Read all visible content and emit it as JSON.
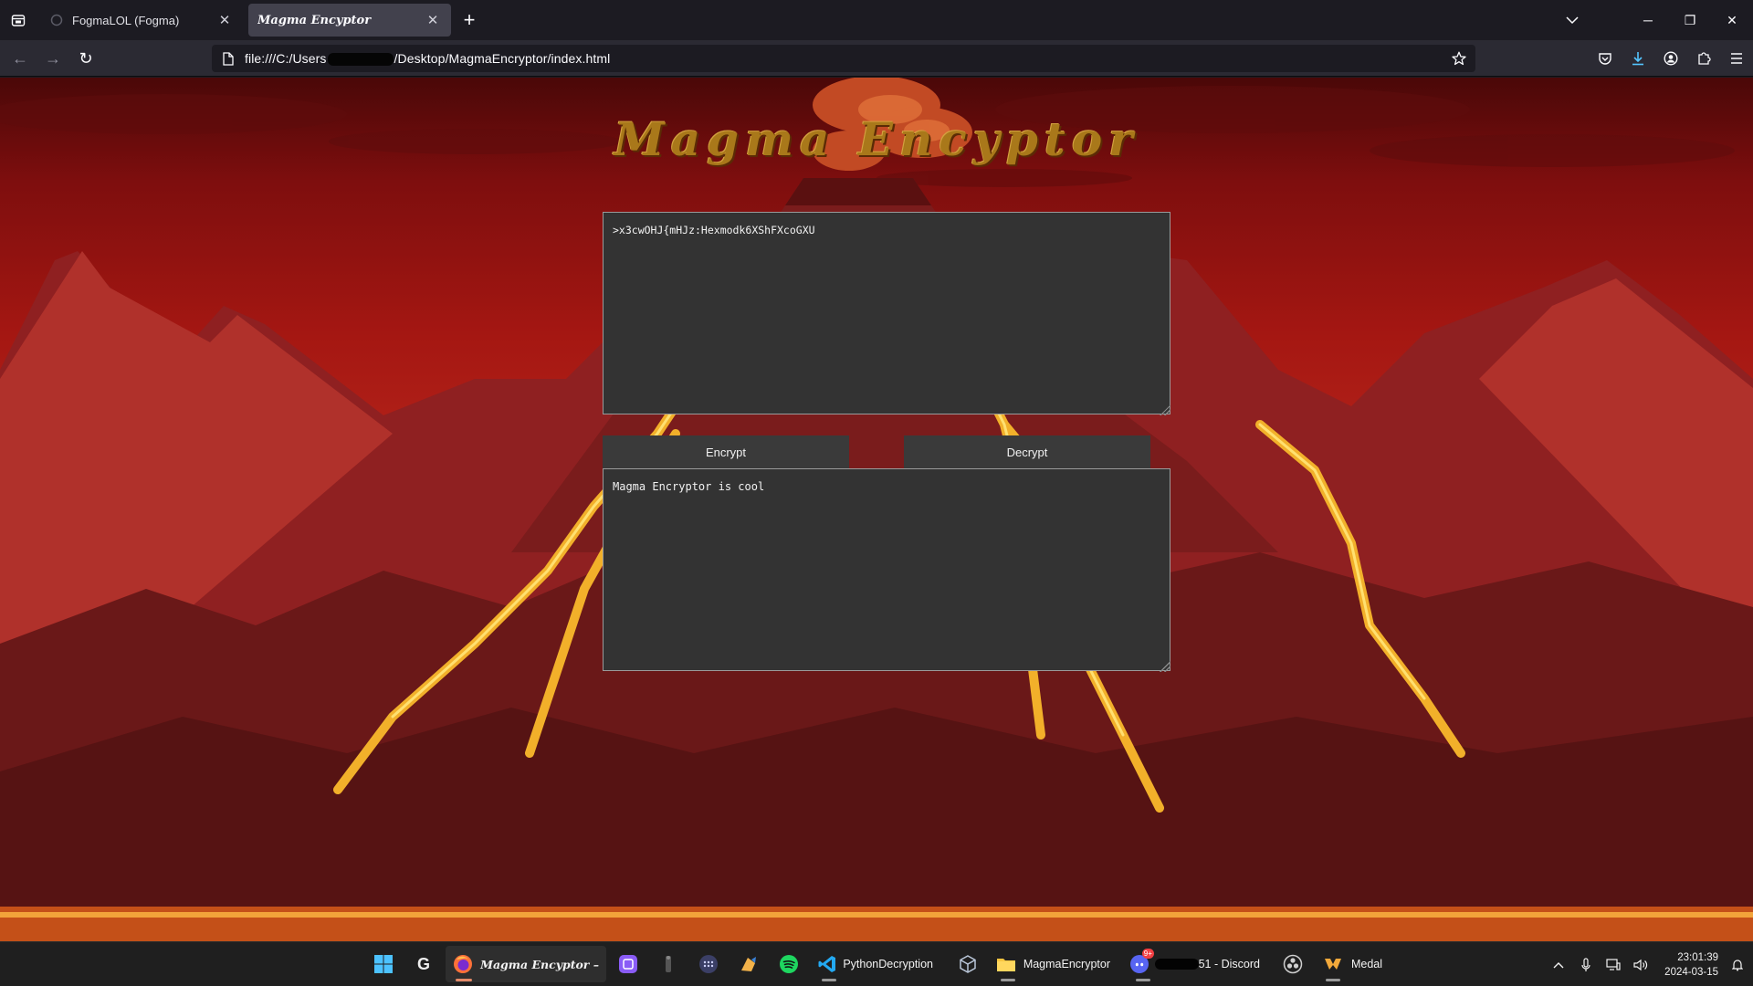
{
  "browser": {
    "tabs": [
      {
        "title": "FogmaLOL (Fogma)",
        "active": false
      },
      {
        "title": "Magma Encyptor",
        "active": true
      }
    ],
    "url": {
      "prefix": "file:///C:/Users",
      "suffix": "/Desktop/MagmaEncryptor/index.html"
    }
  },
  "page": {
    "title": "Magma Encyptor",
    "input_text": ">x3cwOHJ{mHJz:Hexmodk6XShFXcoGXU",
    "output_text": "Magma Encryptor is cool",
    "encrypt_label": "Encrypt",
    "decrypt_label": "Decrypt"
  },
  "taskbar": {
    "items": [
      {
        "label": "Magma Encyptor –",
        "icon": "firefox-icon"
      },
      {
        "label": "PythonDecryption",
        "icon": "vscode-icon"
      },
      {
        "label": "MagmaEncryptor",
        "icon": "folder-icon"
      },
      {
        "label": "51 - Discord",
        "icon": "discord-icon"
      },
      {
        "label": "Medal",
        "icon": "medal-icon"
      }
    ],
    "discord_badge": "9+",
    "clock": {
      "time": "23:01:39",
      "date": "2024-03-15"
    }
  },
  "colors": {
    "accent": "#a9781a",
    "browser_bg": "#1c1b22",
    "textarea_bg": "#333333"
  }
}
